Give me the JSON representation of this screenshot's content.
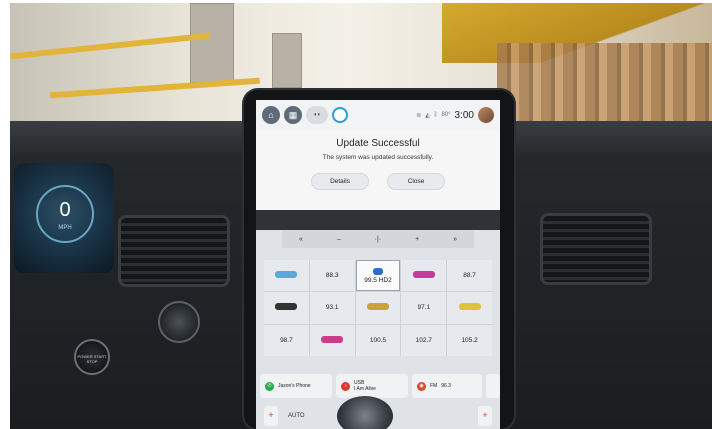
{
  "status_bar": {
    "temperature": "80°",
    "time": "3:00"
  },
  "modal": {
    "title": "Update Successful",
    "message": "The system was updated successfully.",
    "details_label": "Details",
    "close_label": "Close"
  },
  "cluster": {
    "speed": "0",
    "unit": "MPH"
  },
  "start_button": {
    "label": "POWER START STOP"
  },
  "controls": [
    "«",
    "–",
    "·|·",
    "+",
    "»"
  ],
  "presets": [
    [
      "",
      "88.3",
      "99.5 HD2",
      "",
      "88.7"
    ],
    [
      "",
      "93.1",
      "",
      "97.1",
      ""
    ],
    [
      "98.7",
      "",
      "100.5",
      "102.7",
      "105.2"
    ]
  ],
  "source_tiles": [
    {
      "icon": "phone-icon",
      "label": "Jason's Phone"
    },
    {
      "icon": "usb-icon",
      "label": "USB\nI Am Alive"
    },
    {
      "icon": "radio-icon",
      "label": "FM",
      "value": "96.3"
    }
  ],
  "climate": {
    "auto_label": "AUTO"
  },
  "colors": {
    "accent_blue": "#2d9bd8",
    "phone_green": "#27a84a",
    "usb_red": "#d93b30",
    "fm_red": "#d94a2b"
  }
}
